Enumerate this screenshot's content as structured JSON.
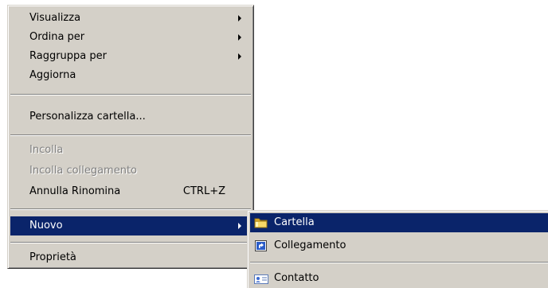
{
  "context_menu": {
    "items": [
      {
        "label": "Visualizza",
        "submenu": true
      },
      {
        "label": "Ordina per",
        "submenu": true
      },
      {
        "label": "Raggruppa per",
        "submenu": true
      },
      {
        "label": "Aggiorna"
      },
      {
        "label": "Personalizza cartella..."
      },
      {
        "label": "Incolla",
        "disabled": true
      },
      {
        "label": "Incolla collegamento",
        "disabled": true
      },
      {
        "label": "Annulla Rinomina",
        "shortcut": "CTRL+Z"
      },
      {
        "label": "Nuovo",
        "submenu": true,
        "selected": true
      },
      {
        "label": "Proprietà"
      }
    ]
  },
  "new_submenu": {
    "items": [
      {
        "label": "Cartella",
        "icon": "folder-icon",
        "selected": true
      },
      {
        "label": "Collegamento",
        "icon": "shortcut-icon"
      },
      {
        "label": "Contatto",
        "icon": "contact-icon"
      }
    ]
  },
  "colors": {
    "menu_background": "#d4d0c8",
    "highlight": "#0a246a",
    "disabled_text": "#808080"
  }
}
